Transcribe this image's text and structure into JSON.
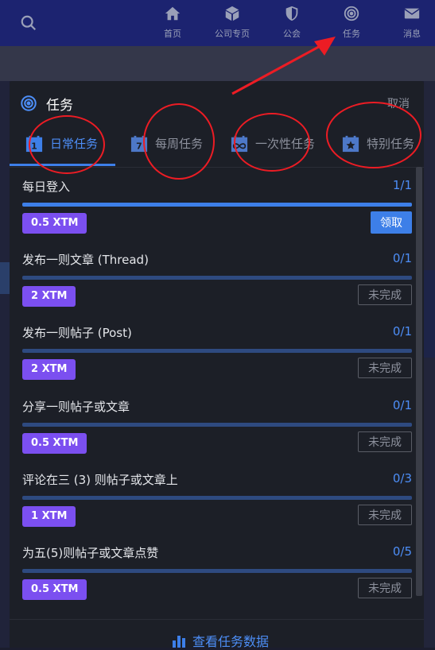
{
  "topnav": {
    "items": [
      {
        "label": "首页",
        "icon": "home-icon"
      },
      {
        "label": "公司专页",
        "icon": "cube-icon"
      },
      {
        "label": "公会",
        "icon": "shield-icon"
      },
      {
        "label": "任务",
        "icon": "target-icon"
      },
      {
        "label": "消息",
        "icon": "mail-icon"
      }
    ],
    "search_icon": "search-icon"
  },
  "modal": {
    "title": "任务",
    "close_label": "取消",
    "tabs": [
      {
        "label": "日常任务",
        "icon": "calendar-day-icon",
        "active": true
      },
      {
        "label": "每周任务",
        "icon": "calendar-week-icon",
        "active": false
      },
      {
        "label": "一次性任务",
        "icon": "infinity-calendar-icon",
        "active": false
      },
      {
        "label": "特别任务",
        "icon": "star-calendar-icon",
        "active": false
      }
    ],
    "tasks": [
      {
        "title": "每日登入",
        "count": "1/1",
        "progress": 1.0,
        "reward": "0.5 XTM",
        "action": "领取",
        "done": true
      },
      {
        "title": "发布一则文章 (Thread)",
        "count": "0/1",
        "progress": 0,
        "reward": "2 XTM",
        "action": "未完成",
        "done": false
      },
      {
        "title": "发布一则帖子 (Post)",
        "count": "0/1",
        "progress": 0,
        "reward": "2 XTM",
        "action": "未完成",
        "done": false
      },
      {
        "title": "分享一则帖子或文章",
        "count": "0/1",
        "progress": 0,
        "reward": "0.5 XTM",
        "action": "未完成",
        "done": false
      },
      {
        "title": "评论在三 (3) 则帖子或文章上",
        "count": "0/3",
        "progress": 0,
        "reward": "1 XTM",
        "action": "未完成",
        "done": false
      },
      {
        "title": "为五(5)则帖子或文章点赞",
        "count": "0/5",
        "progress": 0,
        "reward": "0.5 XTM",
        "action": "未完成",
        "done": false
      }
    ],
    "footer_link": "查看任务数据"
  },
  "colors": {
    "accent": "#3d7fe8",
    "reward": "#7b4ff0",
    "annotation": "#ec1c24",
    "nav_bg": "#1c2370"
  }
}
